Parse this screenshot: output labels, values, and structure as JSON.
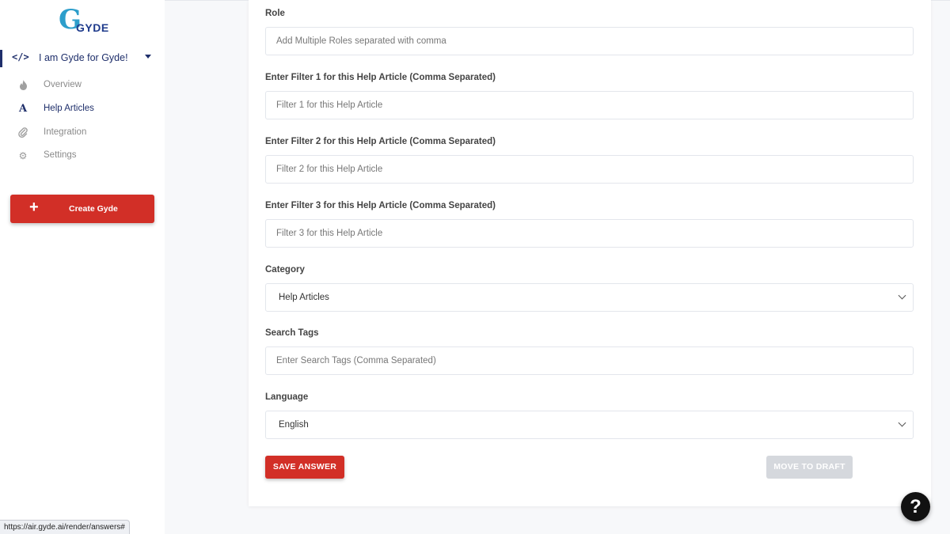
{
  "brand": {
    "logo_letter": "G",
    "logo_wordmark": "GYDE"
  },
  "sidebar": {
    "project_icon": "</>",
    "project_name": "I am Gyde for Gyde!",
    "items": [
      {
        "label": "Overview",
        "icon": "flame-icon",
        "glyph": "🔥"
      },
      {
        "label": "Help Articles",
        "icon": "letter-a-icon",
        "glyph": "A"
      },
      {
        "label": "Integration",
        "icon": "paperclip-icon",
        "glyph": "📎"
      },
      {
        "label": "Settings",
        "icon": "gear-icon",
        "glyph": "⚙"
      }
    ],
    "create_button": {
      "plus": "+",
      "label": "Create Gyde"
    }
  },
  "form": {
    "role": {
      "label": "Role",
      "placeholder": "Add Multiple Roles separated with comma"
    },
    "filter1": {
      "label": "Enter Filter 1 for this Help Article (Comma Separated)",
      "placeholder": "Filter 1 for this Help Article"
    },
    "filter2": {
      "label": "Enter Filter 2 for this Help Article (Comma Separated)",
      "placeholder": "Filter 2 for this Help Article"
    },
    "filter3": {
      "label": "Enter Filter 3 for this Help Article (Comma Separated)",
      "placeholder": "Filter 3 for this Help Article"
    },
    "category": {
      "label": "Category",
      "value": "Help Articles"
    },
    "search_tags": {
      "label": "Search Tags",
      "placeholder": "Enter Search Tags (Comma Separated)"
    },
    "language": {
      "label": "Language",
      "value": "English"
    }
  },
  "actions": {
    "save_label": "SAVE ANSWER",
    "draft_label": "MOVE TO DRAFT"
  },
  "help_glyph": "?",
  "status_url": "https://air.gyde.ai/render/answers#",
  "colors": {
    "primary_red": "#d22f27",
    "navy": "#1f2f6b",
    "disabled": "#d5d8dd"
  }
}
